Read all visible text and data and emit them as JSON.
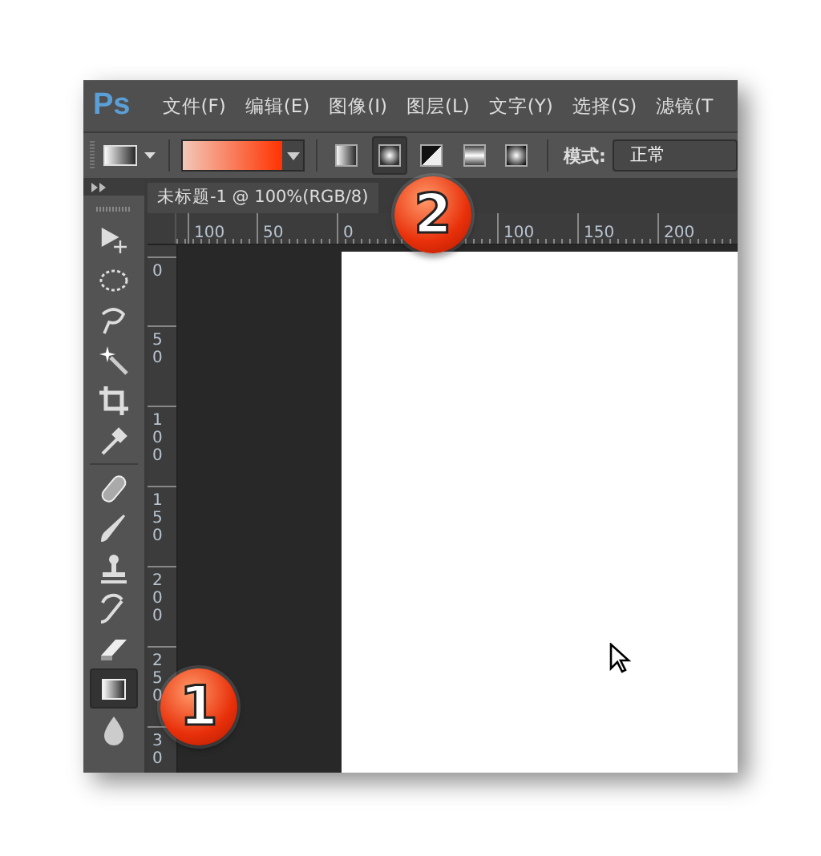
{
  "app": {
    "logo": "Ps"
  },
  "menu": [
    "文件(F)",
    "编辑(E)",
    "图像(I)",
    "图层(L)",
    "文字(Y)",
    "选择(S)",
    "滤镜(T"
  ],
  "options_bar": {
    "gradient_types": [
      {
        "kind": "linear",
        "selected": false
      },
      {
        "kind": "radial",
        "selected": true
      },
      {
        "kind": "angle",
        "selected": false
      },
      {
        "kind": "reflected",
        "selected": false
      },
      {
        "kind": "diamond",
        "selected": false
      }
    ],
    "mode_label": "模式:",
    "mode_value": "正常"
  },
  "document_tab": {
    "title": "未标题-1 @ 100%(RGB/8)"
  },
  "rulers": {
    "horizontal": [
      "100",
      "50",
      "0",
      "100",
      "150",
      "200"
    ],
    "vertical": [
      "0",
      "50",
      "100",
      "150",
      "200",
      "250",
      "30"
    ]
  },
  "tools": [
    {
      "kind": "move",
      "selected": false
    },
    {
      "kind": "marquee",
      "selected": false
    },
    {
      "kind": "lasso",
      "selected": false
    },
    {
      "kind": "wand",
      "selected": false
    },
    {
      "kind": "crop",
      "selected": false
    },
    {
      "kind": "eyedropper",
      "selected": false
    },
    {
      "kind": "healing",
      "selected": false
    },
    {
      "kind": "brush",
      "selected": false
    },
    {
      "kind": "stamp",
      "selected": false
    },
    {
      "kind": "history",
      "selected": false
    },
    {
      "kind": "eraser",
      "selected": false
    },
    {
      "kind": "gradient",
      "selected": true
    },
    {
      "kind": "blur",
      "selected": false
    }
  ],
  "badges": [
    {
      "text": "1"
    },
    {
      "text": "2"
    }
  ]
}
